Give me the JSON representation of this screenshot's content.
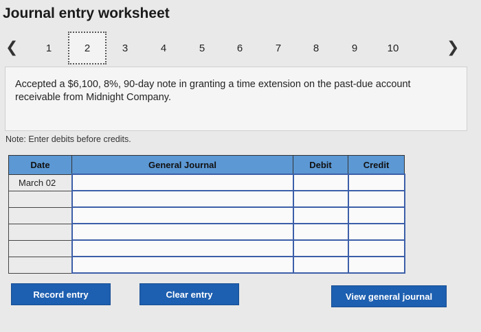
{
  "title": "Journal entry worksheet",
  "pager": {
    "prev_icon": "chevron-left-icon",
    "next_icon": "chevron-right-icon",
    "pages": [
      "1",
      "2",
      "3",
      "4",
      "5",
      "6",
      "7",
      "8",
      "9",
      "10"
    ],
    "current_page": "2"
  },
  "prompt": "Accepted a $6,100, 8%, 90-day note in granting a time extension on the past-due account receivable from Midnight Company.",
  "note": "Note: Enter debits before credits.",
  "table": {
    "headers": {
      "date": "Date",
      "journal": "General Journal",
      "debit": "Debit",
      "credit": "Credit"
    },
    "rows": [
      {
        "date": "March 02",
        "account": "",
        "debit": "",
        "credit": ""
      },
      {
        "date": "",
        "account": "",
        "debit": "",
        "credit": ""
      },
      {
        "date": "",
        "account": "",
        "debit": "",
        "credit": ""
      },
      {
        "date": "",
        "account": "",
        "debit": "",
        "credit": ""
      },
      {
        "date": "",
        "account": "",
        "debit": "",
        "credit": ""
      },
      {
        "date": "",
        "account": "",
        "debit": "",
        "credit": ""
      }
    ]
  },
  "buttons": {
    "record": "Record entry",
    "clear": "Clear entry",
    "view": "View general journal"
  },
  "colors": {
    "header_bg": "#5c98d4",
    "button_bg": "#1d5fb0"
  }
}
